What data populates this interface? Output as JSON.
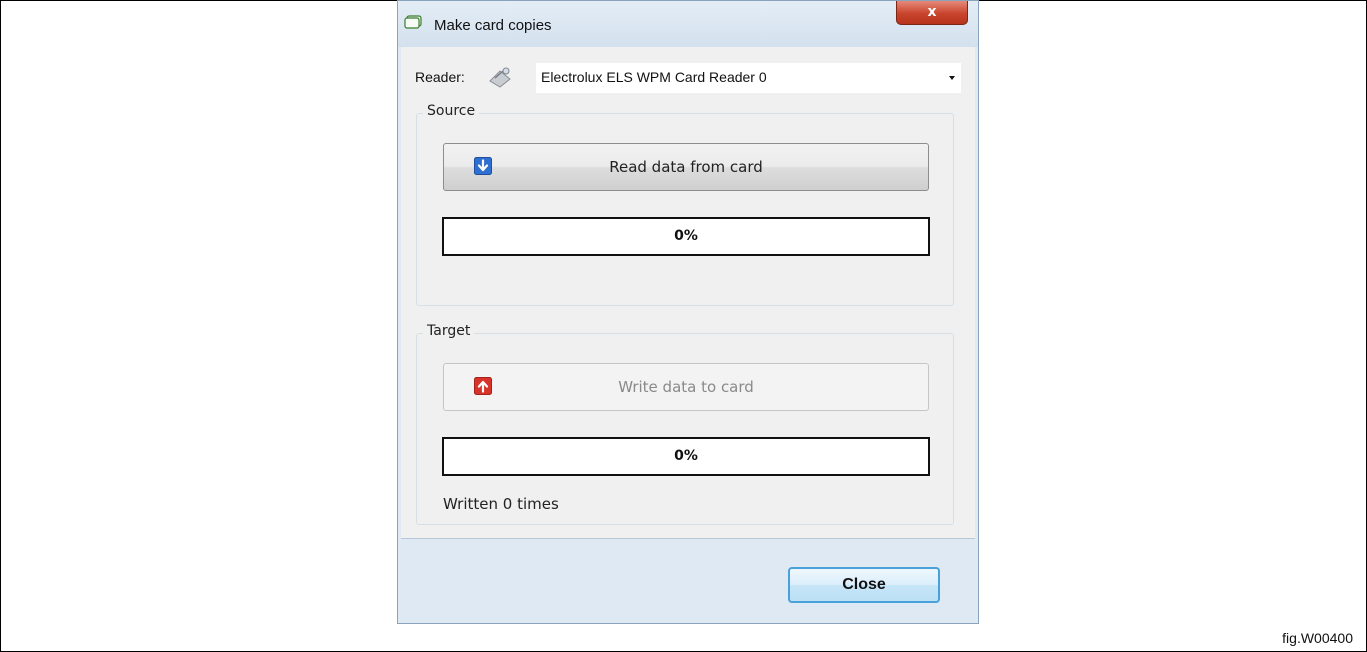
{
  "window": {
    "title": "Make card copies",
    "close_glyph": "x"
  },
  "reader": {
    "label": "Reader:",
    "icon": "card-reader-icon",
    "selected": "Electrolux ELS WPM Card Reader 0"
  },
  "source": {
    "group_title": "Source",
    "button_label": "Read data from card",
    "button_icon": "arrow-down-icon",
    "progress_fraction": 0,
    "progress_text": "0%"
  },
  "target": {
    "group_title": "Target",
    "button_label": "Write data to card",
    "button_icon": "arrow-up-icon",
    "button_enabled": false,
    "progress_fraction": 0,
    "progress_text": "0%",
    "written_text": "Written 0 times"
  },
  "footer": {
    "close_label": "Close"
  },
  "figure_caption": "fig.W00400",
  "colors": {
    "read_icon": "#2f6fd1",
    "write_icon": "#d8332a",
    "accent": "#48a1d8"
  }
}
